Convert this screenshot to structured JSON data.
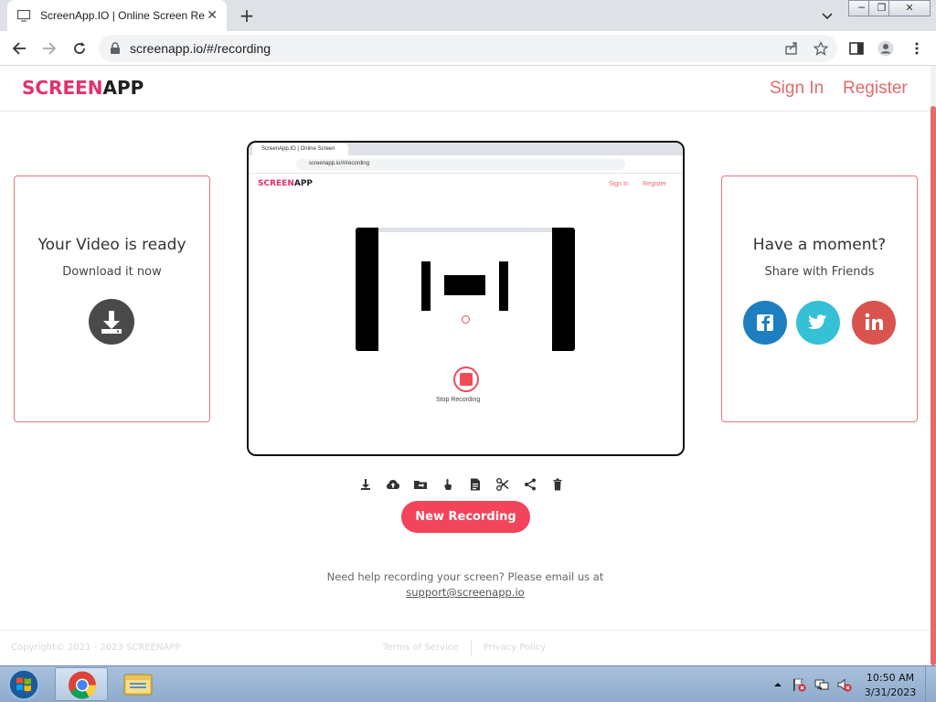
{
  "browser": {
    "tab_title": "ScreenApp.IO | Online Screen Re",
    "tab_close": "✕",
    "new_tab": "+",
    "url": "screenapp.io/#/recording"
  },
  "header": {
    "logo_part1": "SCREEN",
    "logo_part2": "APP",
    "sign_in": "Sign In",
    "register": "Register"
  },
  "left_card": {
    "title": "Your Video is ready",
    "subtitle": "Download it now"
  },
  "right_card": {
    "title": "Have a moment?",
    "subtitle": "Share with Friends",
    "buttons": [
      {
        "name": "facebook",
        "glyph": "f",
        "color": "#1d7fbf"
      },
      {
        "name": "twitter",
        "glyph": "t",
        "color": "#35c0d6"
      },
      {
        "name": "linkedin",
        "glyph": "in",
        "color": "#d9544f"
      }
    ]
  },
  "preview": {
    "tab_title": "ScreenApp.IO | Online Screen",
    "url": "screenapp.io/#/recording",
    "logo_part1": "SCREEN",
    "logo_part2": "APP",
    "sign_in": "Sign In",
    "register": "Register",
    "stop_label": "Stop Recording"
  },
  "actions": [
    "download-icon",
    "cloud-upload-icon",
    "folder-icon",
    "touch-icon",
    "document-icon",
    "scissors-icon",
    "share-icon",
    "trash-icon"
  ],
  "new_recording": "New Recording",
  "help": {
    "text": "Need help recording your screen? Please email us at",
    "email": "support@screenapp.io"
  },
  "footer": {
    "copyright": "Copyright© 2021 - 2023 SCREENAPP",
    "terms": "Terms of Service",
    "privacy": "Privacy Policy"
  },
  "taskbar": {
    "time": "10:50 AM",
    "date": "3/31/2023"
  },
  "colors": {
    "accent": "#e36a6a",
    "brand_pink": "#e52f6c",
    "button_red": "#f2445a"
  }
}
